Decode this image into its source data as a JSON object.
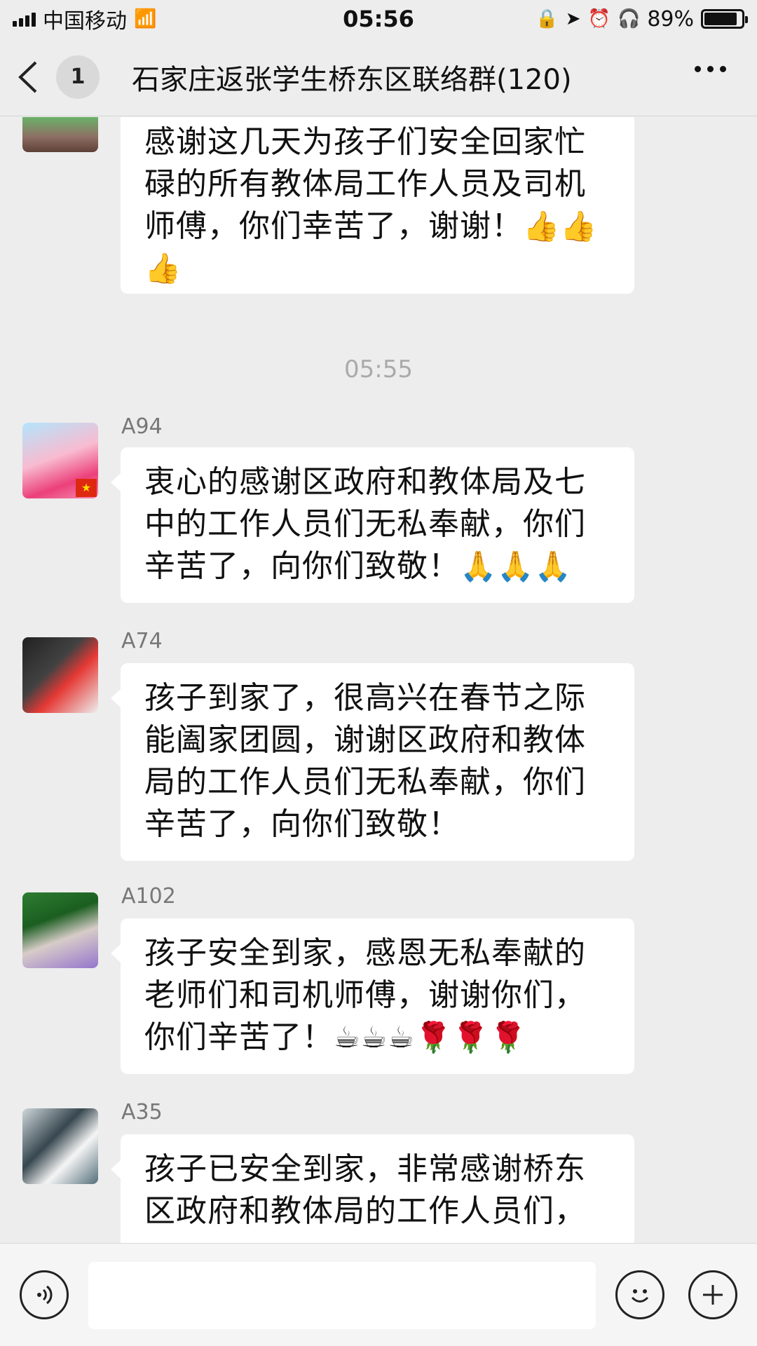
{
  "status_bar": {
    "carrier": "中国移动",
    "time": "05:56",
    "battery_percent_text": "89%",
    "battery_level": 0.89
  },
  "nav": {
    "unread_count": "1",
    "title": "石家庄返张学生桥东区联络群(120)"
  },
  "messages": [
    {
      "sender": "",
      "text": "感谢这几天为孩子们安全回家忙碌的所有教体局工作人员及司机师傅，你们幸苦了，谢谢！",
      "emoji": "👍👍👍"
    },
    {
      "type": "time",
      "text": "05:55"
    },
    {
      "sender": "A94",
      "text": "衷心的感谢区政府和教体局及七中的工作人员们无私奉献，你们辛苦了，向你们致敬！",
      "emoji": "🙏🙏🙏"
    },
    {
      "sender": "A74",
      "text": "孩子到家了，很高兴在春节之际能阖家团圆，谢谢区政府和教体局的工作人员们无私奉献，你们辛苦了，向你们致敬！",
      "emoji": ""
    },
    {
      "sender": "A102",
      "text": "孩子安全到家，感恩无私奉献的老师们和司机师傅，谢谢你们，你们辛苦了！",
      "emoji": "☕☕☕🌹🌹🌹"
    },
    {
      "sender": "A35",
      "text": "孩子已安全到家，非常感谢桥东区政府和教体局的工作人员们，",
      "emoji": ""
    }
  ],
  "input": {
    "placeholder": ""
  },
  "icons": {
    "voice": "voice-icon",
    "emoji": "emoji-icon",
    "plus": "plus-icon"
  }
}
